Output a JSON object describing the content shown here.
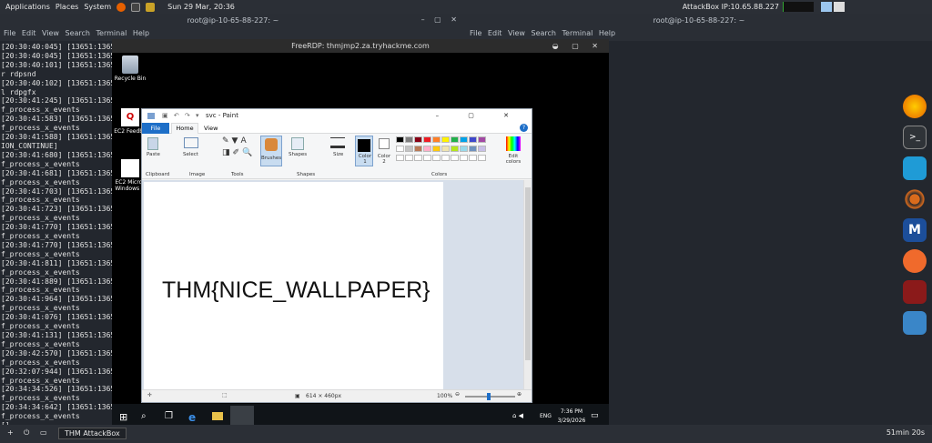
{
  "topbar": {
    "menus": [
      "Applications",
      "Places",
      "System"
    ],
    "datetime": "Sun 29 Mar, 20:36",
    "attackbox": "AttackBox IP:10.65.88.227"
  },
  "terminal_left": {
    "title": "root@ip-10-65-88-227: ~",
    "menu": "File  Edit  View  Search  Terminal  Help",
    "lines": [
      "[20:30:40:045] [13651:1365",
      "[20:30:40:045] [13651:1365",
      "[20:30:40:101] [13651:1365",
      "r rdpsnd",
      "[20:30:40:102] [13651:1365",
      "l rdpgfx",
      "[20:30:41:245] [13651:1365",
      "f_process_x_events",
      "[20:30:41:583] [13651:1365",
      "f_process_x_events",
      "[20:30:41:588] [13651:1365",
      "ION_CONTINUE]",
      "[20:30:41:680] [13651:1365",
      "f_process_x_events",
      "[20:30:41:681] [13651:1365",
      "f_process_x_events",
      "[20:30:41:703] [13651:1365",
      "f_process_x_events",
      "[20:30:41:723] [13651:1365",
      "f_process_x_events",
      "[20:30:41:770] [13651:1365",
      "f_process_x_events",
      "[20:30:41:770] [13651:1365",
      "f_process_x_events",
      "[20:30:41:811] [13651:1365",
      "f_process_x_events",
      "[20:30:41:889] [13651:1365",
      "f_process_x_events",
      "[20:30:41:964] [13651:1365",
      "f_process_x_events",
      "[20:30:41:076] [13651:1365",
      "f_process_x_events",
      "[20:30:41:131] [13651:1365",
      "f_process_x_events",
      "[20:30:42:570] [13651:1365",
      "f_process_x_events",
      "[20:32:07:944] [13651:1365",
      "f_process_x_events",
      "[20:34:34:526] [13651:1365",
      "f_process_x_events",
      "[20:34:34:642] [13651:1365",
      "f_process_x_events",
      "[]"
    ]
  },
  "terminal_right": {
    "title": "root@ip-10-65-88-227: ~",
    "menu": "File  Edit  View  Search  Terminal  Help"
  },
  "rdp": {
    "title": "FreeRDP: thmjmp2.za.tryhackme.com",
    "desktop_icons": [
      "Recycle Bin",
      "EC2 Feedba",
      "EC2 Micros Windows G"
    ]
  },
  "paint": {
    "title": "svc - Paint",
    "tabs": [
      "File",
      "Home",
      "View"
    ],
    "groups": {
      "clipboard": "Clipboard",
      "paste": "Paste",
      "image": "Image",
      "select": "Select",
      "tools": "Tools",
      "brushes": "Brushes",
      "shapes_btn": "Shapes",
      "shapes": "Shapes",
      "size": "Size",
      "color1": "Color 1",
      "color2": "Color 2",
      "colors": "Colors",
      "edit_colors": "Edit colors"
    },
    "palette": [
      "#000000",
      "#7f7f7f",
      "#880015",
      "#ed1c24",
      "#ff7f27",
      "#fff200",
      "#22b14c",
      "#00a2e8",
      "#3f48cc",
      "#a349a4",
      "#ffffff",
      "#c3c3c3",
      "#b97a57",
      "#ffaec9",
      "#ffc90e",
      "#efe4b0",
      "#b5e61d",
      "#99d9ea",
      "#7092be",
      "#c8bfe7"
    ],
    "canvas_text": "THM{NICE_WALLPAPER}",
    "status_size": "614 × 460px",
    "zoom": "100%"
  },
  "taskbar": {
    "lang": "ENG",
    "time": "7:36 PM",
    "date": "3/29/2026"
  },
  "bottombar": {
    "window": "THM AttackBox",
    "timer": "51min 20s"
  }
}
